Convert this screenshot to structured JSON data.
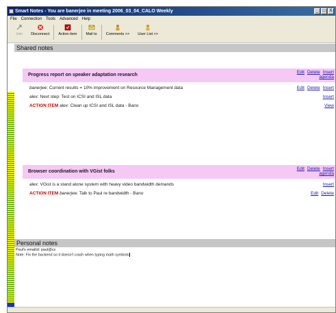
{
  "window": {
    "title": "Smart Notes - You are banerjee in meeting 2006_03_04_CALO Weekly",
    "controls": [
      "_",
      "□",
      "X"
    ]
  },
  "menu": [
    "File",
    "Connection",
    "Tools",
    "Advanced",
    "Help"
  ],
  "toolbar": [
    {
      "label": "Join",
      "icon": "join-icon",
      "enabled": false
    },
    {
      "label": "Disconnect",
      "icon": "disconnect-icon",
      "enabled": true
    },
    {
      "label": "Action item",
      "icon": "action-item-icon",
      "enabled": true
    },
    {
      "label": "Mail to",
      "icon": "mail-icon",
      "enabled": true
    },
    {
      "label": "Comments >>",
      "icon": "comments-icon",
      "enabled": true
    },
    {
      "label": "User List >>",
      "icon": "user-list-icon",
      "enabled": true
    }
  ],
  "shared": {
    "header": "Shared notes",
    "topics": [
      {
        "title": "Progress report on speaker adaptation research",
        "actions": {
          "edit": "Edit",
          "delete": "Delete",
          "insert": "Insert",
          "agenda": "agenda"
        },
        "notes": [
          {
            "action_item": "",
            "author": "banerjee",
            "text": ": Current results = 10% improvement on Resource Management data",
            "links": [
              "Edit",
              "Delete",
              "Insert"
            ]
          },
          {
            "action_item": "",
            "author": "alex",
            "text": ": Next step: Test on ICSI and ISL data",
            "links": [
              "Insert"
            ]
          },
          {
            "action_item": "ACTION ITEM",
            "author": "alex",
            "text": ": Clean up ICSI and ISL data - Bano",
            "links": [
              "View"
            ]
          }
        ]
      },
      {
        "title": "Browser coordination with VGist folks",
        "actions": {
          "edit": "Edit",
          "delete": "Delete",
          "insert": "Insert",
          "agenda": "agenda"
        },
        "notes": [
          {
            "action_item": "",
            "author": "alex",
            "text": ": VGist is a stand alone system with heavy video bandwidth demands",
            "links": [
              "Insert"
            ]
          },
          {
            "action_item": "ACTION ITEM",
            "author": "banerjee",
            "text": ": Talk to Paul re bandwidth - Bano",
            "links": [
              "Edit",
              "Delete"
            ]
          }
        ]
      }
    ]
  },
  "personal": {
    "header": "Personal notes",
    "lines": [
      "Paul's emailid: paul@cs",
      "Note: Fix the backend so it doesn't crash when typing math symbols"
    ]
  },
  "colors": {
    "title_bar": "#0a246a",
    "topic_bg": "#f6c8f6",
    "action_item": "#c00000",
    "link": "#1a1aa6",
    "section_header": "#c6c6c6"
  }
}
